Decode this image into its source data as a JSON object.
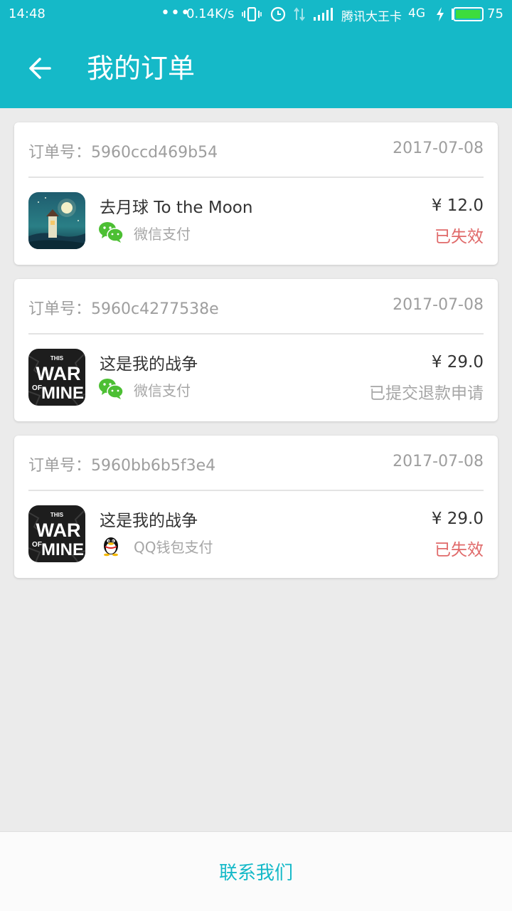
{
  "status_bar": {
    "time": "14:48",
    "dots": "•••",
    "speed": "0.14K/s",
    "carrier": "腾讯大王卡",
    "network": "4G",
    "battery": "75",
    "battery_color": "#3ddc3d"
  },
  "app_bar": {
    "title": "我的订单",
    "color": "#15b9c8"
  },
  "orders": [
    {
      "label": "订单号：5960ccd469b54",
      "date": "2017-07-08",
      "title": "去月球 To the Moon",
      "pay_method": "微信支付",
      "pay_icon": "wechat-icon",
      "price": "¥ 12.0",
      "status": "已失效",
      "status_color": "#e06a6a",
      "game_icon": "to-the-moon-icon"
    },
    {
      "label": "订单号：5960c4277538e",
      "date": "2017-07-08",
      "title": "这是我的战争",
      "pay_method": "微信支付",
      "pay_icon": "wechat-icon",
      "price": "¥ 29.0",
      "status": "已提交退款申请",
      "status_color": "#a6a6a6",
      "game_icon": "this-war-of-mine-icon",
      "icon_text": {
        "this": "THIS",
        "war": "WAR",
        "of": "OF",
        "mine": "MINE"
      }
    },
    {
      "label": "订单号：5960bb6b5f3e4",
      "date": "2017-07-08",
      "title": "这是我的战争",
      "pay_method": "QQ钱包支付",
      "pay_icon": "qq-penguin-icon",
      "price": "¥ 29.0",
      "status": "已失效",
      "status_color": "#e06a6a",
      "game_icon": "this-war-of-mine-icon",
      "icon_text": {
        "this": "THIS",
        "war": "WAR",
        "of": "OF",
        "mine": "MINE"
      }
    }
  ],
  "footer": {
    "contact_label": "联系我们"
  }
}
